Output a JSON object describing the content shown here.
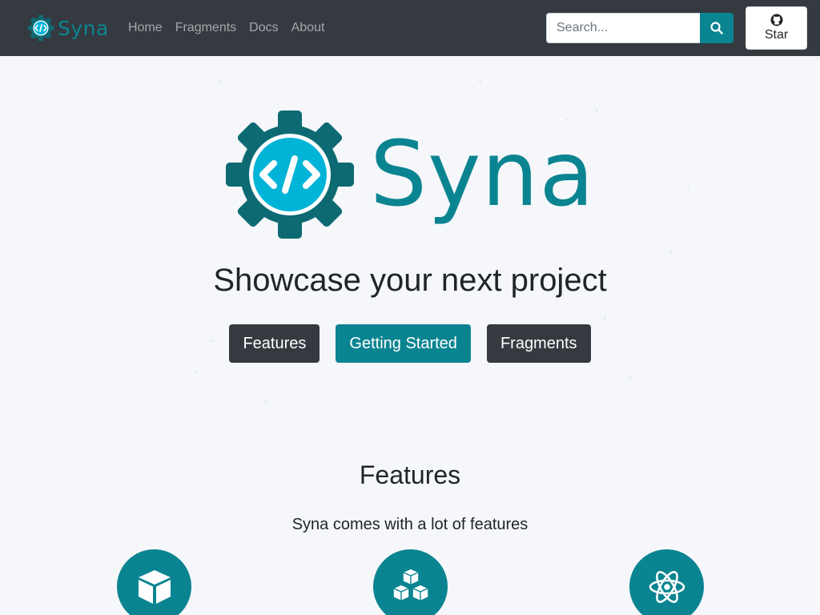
{
  "navbar": {
    "brand": "Syna",
    "links": [
      "Home",
      "Fragments",
      "Docs",
      "About"
    ],
    "search_placeholder": "Search...",
    "star_label": "Star"
  },
  "hero": {
    "logo_text": "Syna",
    "title": "Showcase your next project",
    "buttons": [
      "Features",
      "Getting Started",
      "Fragments"
    ]
  },
  "features": {
    "title": "Features",
    "subtitle": "Syna comes with a lot of features",
    "icons": [
      "box-icon",
      "cubes-icon",
      "atom-icon"
    ]
  },
  "colors": {
    "navbar": "#343a40",
    "accent": "#0b8491",
    "logo_gear": "#0d6a73",
    "logo_inner": "#00b4d8",
    "background": "#f5f7fa"
  }
}
